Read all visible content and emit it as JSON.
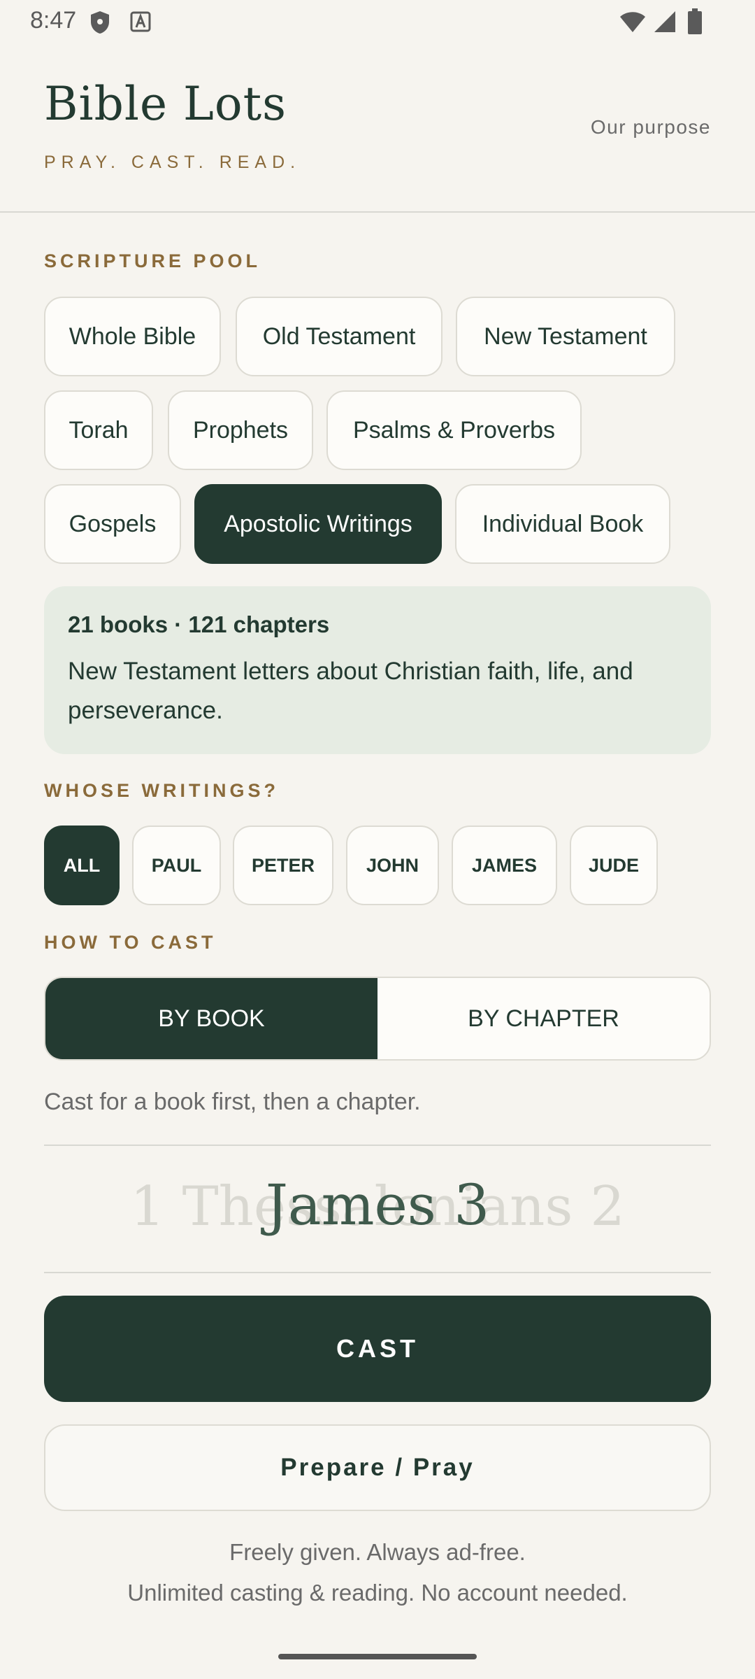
{
  "status_bar": {
    "time": "8:47"
  },
  "header": {
    "title": "Bible Lots",
    "tagline": "PRAY. CAST. READ.",
    "purpose_link": "Our purpose"
  },
  "scripture_pool": {
    "label": "SCRIPTURE POOL",
    "options": [
      "Whole Bible",
      "Old Testament",
      "New Testament",
      "Torah",
      "Prophets",
      "Psalms & Proverbs",
      "Gospels",
      "Apostolic Writings",
      "Individual Book"
    ],
    "selected": "Apostolic Writings"
  },
  "info": {
    "summary": "21 books · 121 chapters",
    "description": "New Testament letters about Christian faith, life, and perseverance."
  },
  "writers": {
    "label": "WHOSE WRITINGS?",
    "options": [
      "ALL",
      "PAUL",
      "PETER",
      "JOHN",
      "JAMES",
      "JUDE"
    ],
    "selected": "ALL"
  },
  "cast_mode": {
    "label": "HOW TO CAST",
    "options": [
      "BY BOOK",
      "BY CHAPTER"
    ],
    "selected": "BY BOOK",
    "hint": "Cast for a book first, then a chapter."
  },
  "reel": {
    "ghost_text": "1 Thessalonians 2",
    "current": "James 3"
  },
  "actions": {
    "cast": "CAST",
    "pray": "Prepare / Pray"
  },
  "footer": {
    "line1": "Freely given. Always ad-free.",
    "line2": "Unlimited casting & reading. No account needed."
  },
  "colors": {
    "primary": "#233a31",
    "accent_gold": "#8a6a3a",
    "background": "#f6f4ef",
    "info_card": "#e6ece3"
  }
}
